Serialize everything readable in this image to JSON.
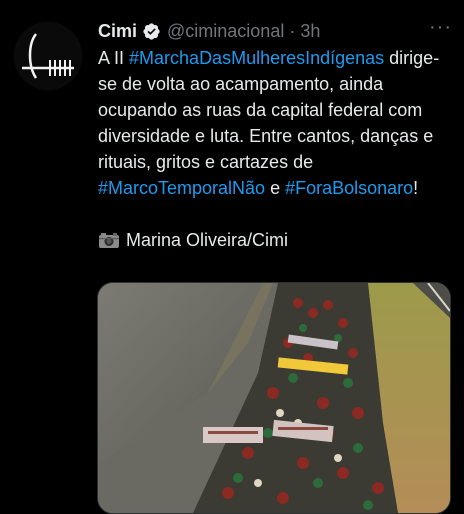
{
  "tweet": {
    "author_name": "Cimi",
    "author_handle": "@ciminacional",
    "separator": "·",
    "time": "3h",
    "more_label": "···",
    "avatar_icon": "cimi-logo",
    "verified_icon": "verified-badge-icon",
    "colors": {
      "link": "#1d9bf0",
      "text": "#e7e9ea",
      "muted": "#71767b",
      "background": "#000000"
    },
    "text": {
      "prefix": "A II ",
      "hashtag1": "#MarchaDasMulheresIndígenas",
      "middle": " dirige-se de volta ao acampamento, ainda ocupando as ruas da capital federal com diversidade e luta. Entre cantos, danças e rituais, gritos e cartazes de ",
      "hashtag2": "#MarcoTemporalNão",
      "connector": " e ",
      "hashtag3": "#ForaBolsonaro",
      "suffix": "!"
    },
    "photo_credit": "Marina Oliveira/Cimi",
    "photo_credit_icon": "camera-icon",
    "media": {
      "type": "photo",
      "description_icon": "march-crowd-photo"
    }
  }
}
